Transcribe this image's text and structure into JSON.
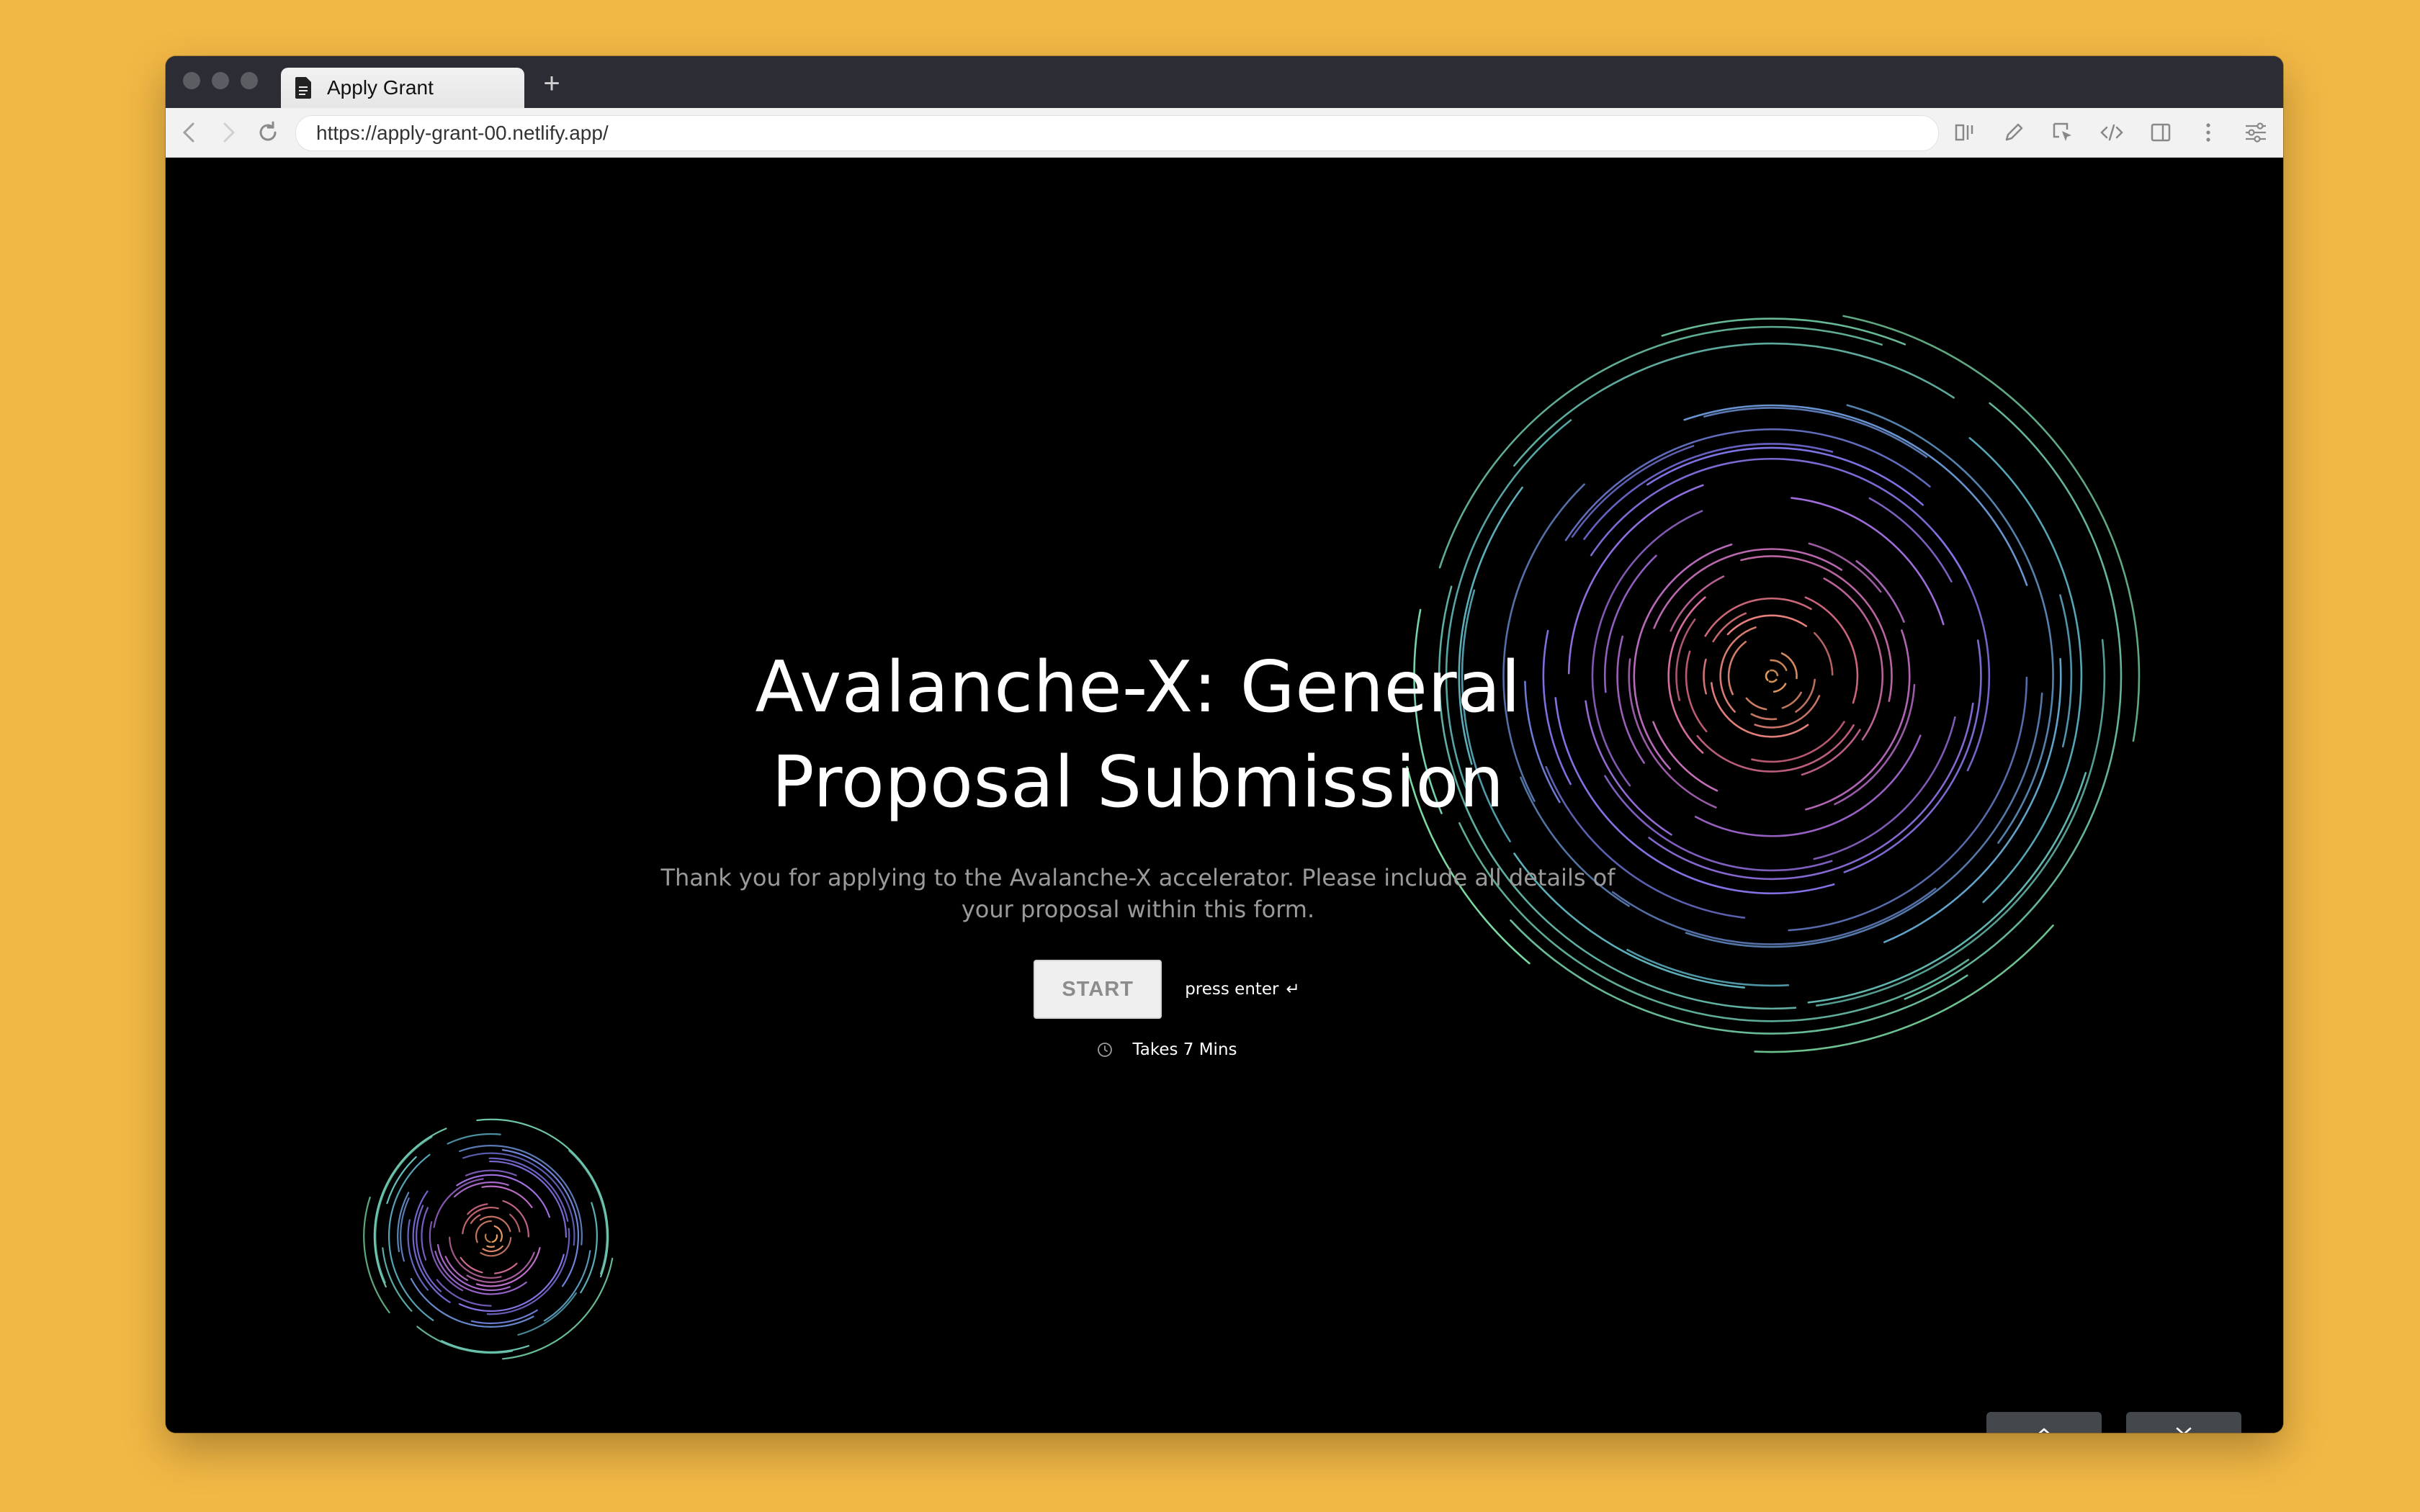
{
  "browser": {
    "tab_title": "Apply Grant",
    "new_tab_label": "+",
    "url": "https://apply-grant-00.netlify.app/",
    "toolbar_icons": [
      "reader-view-icon",
      "pen-icon",
      "cursor-select-icon",
      "code-icon",
      "sidebar-icon",
      "more-icon",
      "sliders-icon"
    ]
  },
  "page": {
    "title": "Avalanche-X: General Proposal Submission",
    "subtitle": "Thank you for applying to the Avalanche-X accelerator. Please include all details of your proposal within this form.",
    "start_label": "START",
    "press_enter": "press enter",
    "enter_icon": "↵",
    "duration": "Takes 7 Mins"
  },
  "controls": {
    "up_icon": "double-chevron-up-icon",
    "down_icon": "double-chevron-down-icon"
  },
  "colors": {
    "background": "#F2B845",
    "page": "#000000",
    "button_bg": "#44484C",
    "ring_colors": [
      "#F5A965",
      "#E5708C",
      "#B070E0",
      "#7A74E6",
      "#5EB5C8",
      "#7FE0A6"
    ]
  }
}
